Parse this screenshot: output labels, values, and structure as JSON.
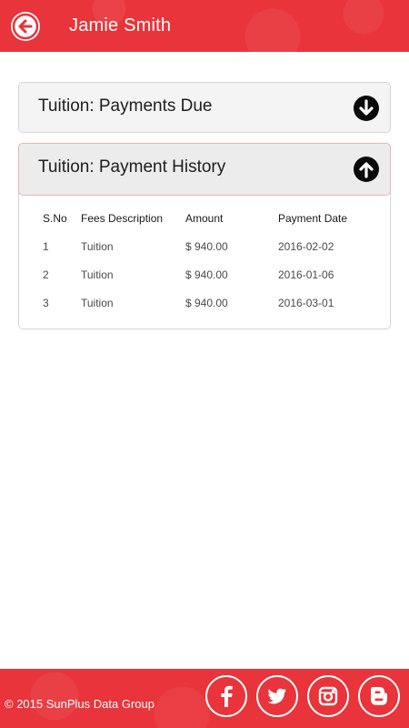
{
  "header": {
    "title": "Jamie Smith",
    "back_icon": "back-arrow-icon",
    "color": "#e8343a"
  },
  "panels": {
    "due": {
      "label": "Tuition: Payments Due",
      "icon": "arrow-down-icon",
      "expanded": false
    },
    "history": {
      "label": "Tuition: Payment History",
      "icon": "arrow-up-icon",
      "expanded": true,
      "columns": [
        "S.No",
        "Fees Description",
        "Amount",
        "Payment Date"
      ],
      "rows": [
        [
          "1",
          "Tuition",
          "$ 940.00",
          "2016-02-02"
        ],
        [
          "2",
          "Tuition",
          "$ 940.00",
          "2016-01-06"
        ],
        [
          "3",
          "Tuition",
          "$ 940.00",
          "2016-03-01"
        ]
      ]
    }
  },
  "footer": {
    "copyright": "© 2015 SunPlus Data Group",
    "social": [
      "facebook-icon",
      "twitter-icon",
      "instagram-icon",
      "blogger-icon"
    ]
  }
}
